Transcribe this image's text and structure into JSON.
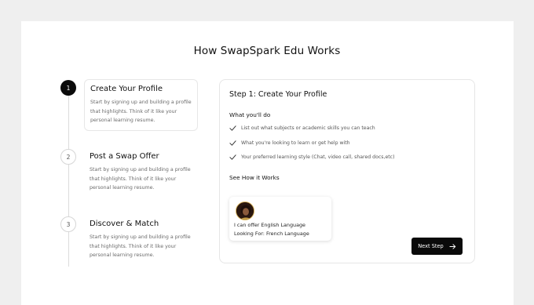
{
  "page": {
    "title": "How SwapSpark Edu Works"
  },
  "steps": [
    {
      "number": "1",
      "title": "Create Your Profile",
      "description": "Start by signing up and building a profile that highlights. Think of it like your personal learning resume."
    },
    {
      "number": "2",
      "title": "Post a Swap Offer",
      "description": "Start by signing up and building a profile that highlights. Think of it like your personal learning resume."
    },
    {
      "number": "3",
      "title": "Discover & Match",
      "description": "Start by signing up and building a profile that highlights. Think of it like your personal learning resume."
    }
  ],
  "detail": {
    "title": "Step 1: Create Your Profile",
    "what_label": "What you'll do",
    "items": [
      "List out what subjects or academic skills you can teach",
      "What you're looking to learn or get help with",
      "Your preferred learning style (Chat, video call, shared docs,etc)"
    ],
    "how_label": "See How it Works",
    "example": {
      "offer": "I can offer English Language",
      "looking": "Looking For: French Language"
    },
    "next_button": "Next Step"
  },
  "colors": {
    "background": "#efefef",
    "panel": "#ffffff",
    "accent": "#0a0a0a",
    "muted_text": "#6b6b6b"
  },
  "icons": {
    "check": "check-icon",
    "arrow": "arrow-right-icon",
    "avatar": "avatar"
  }
}
